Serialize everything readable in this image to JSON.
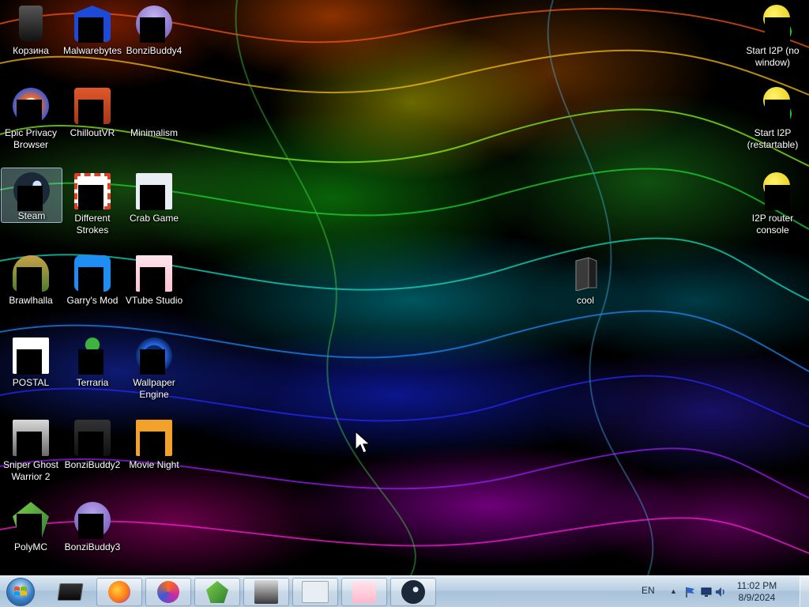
{
  "desktop": {
    "icons": [
      {
        "label": "Корзина",
        "icon": "recycle-bin-icon"
      },
      {
        "label": "Malwarebytes",
        "icon": "malwarebytes-icon"
      },
      {
        "label": "BonziBuddy4",
        "icon": "bonzibuddy-icon"
      },
      {
        "label": "Epic Privacy Browser",
        "icon": "epic-browser-icon"
      },
      {
        "label": "ChilloutVR",
        "icon": "chilloutvr-icon"
      },
      {
        "label": "Minimalism",
        "icon": "minimalism-icon"
      },
      {
        "label": "Steam",
        "icon": "steam-icon"
      },
      {
        "label": "Different Strokes",
        "icon": "different-strokes-icon"
      },
      {
        "label": "Crab Game",
        "icon": "crab-game-icon"
      },
      {
        "label": "Brawlhalla",
        "icon": "brawlhalla-icon"
      },
      {
        "label": "Garry's Mod",
        "icon": "garrys-mod-icon"
      },
      {
        "label": "VTube Studio",
        "icon": "vtube-studio-icon"
      },
      {
        "label": "POSTAL",
        "icon": "postal-icon"
      },
      {
        "label": "Terraria",
        "icon": "terraria-icon"
      },
      {
        "label": "Wallpaper Engine",
        "icon": "wallpaper-engine-icon"
      },
      {
        "label": "Sniper Ghost Warrior 2",
        "icon": "sniper-ghost-warrior-icon"
      },
      {
        "label": "BonziBuddy2",
        "icon": "bonzibuddy-icon"
      },
      {
        "label": "Movie Night",
        "icon": "movie-night-icon"
      },
      {
        "label": "PolyMC",
        "icon": "polymc-icon"
      },
      {
        "label": "BonziBuddy3",
        "icon": "bonzibuddy-icon"
      },
      {
        "label": "Start I2P (no window)",
        "icon": "i2p-icon"
      },
      {
        "label": "Start I2P (restartable)",
        "icon": "i2p-icon"
      },
      {
        "label": "I2P router console",
        "icon": "i2p-icon"
      },
      {
        "label": "cool",
        "icon": "folder-icon"
      }
    ]
  },
  "taskbar": {
    "pinned": [
      {
        "icon": "terminal-icon"
      },
      {
        "icon": "firefox-icon"
      },
      {
        "icon": "epic-browser-icon"
      },
      {
        "icon": "polymc-icon"
      },
      {
        "icon": "sniper-ghost-warrior-icon"
      },
      {
        "icon": "crab-game-icon"
      },
      {
        "icon": "vtube-studio-icon"
      },
      {
        "icon": "steam-icon"
      }
    ],
    "tray": {
      "language": "EN",
      "time": "11:02 PM",
      "date": "8/9/2024"
    }
  },
  "colors": {
    "taskbar_top": "#dbe7f2",
    "taskbar_bottom": "#b8cde2",
    "label_text": "#ffffff"
  }
}
